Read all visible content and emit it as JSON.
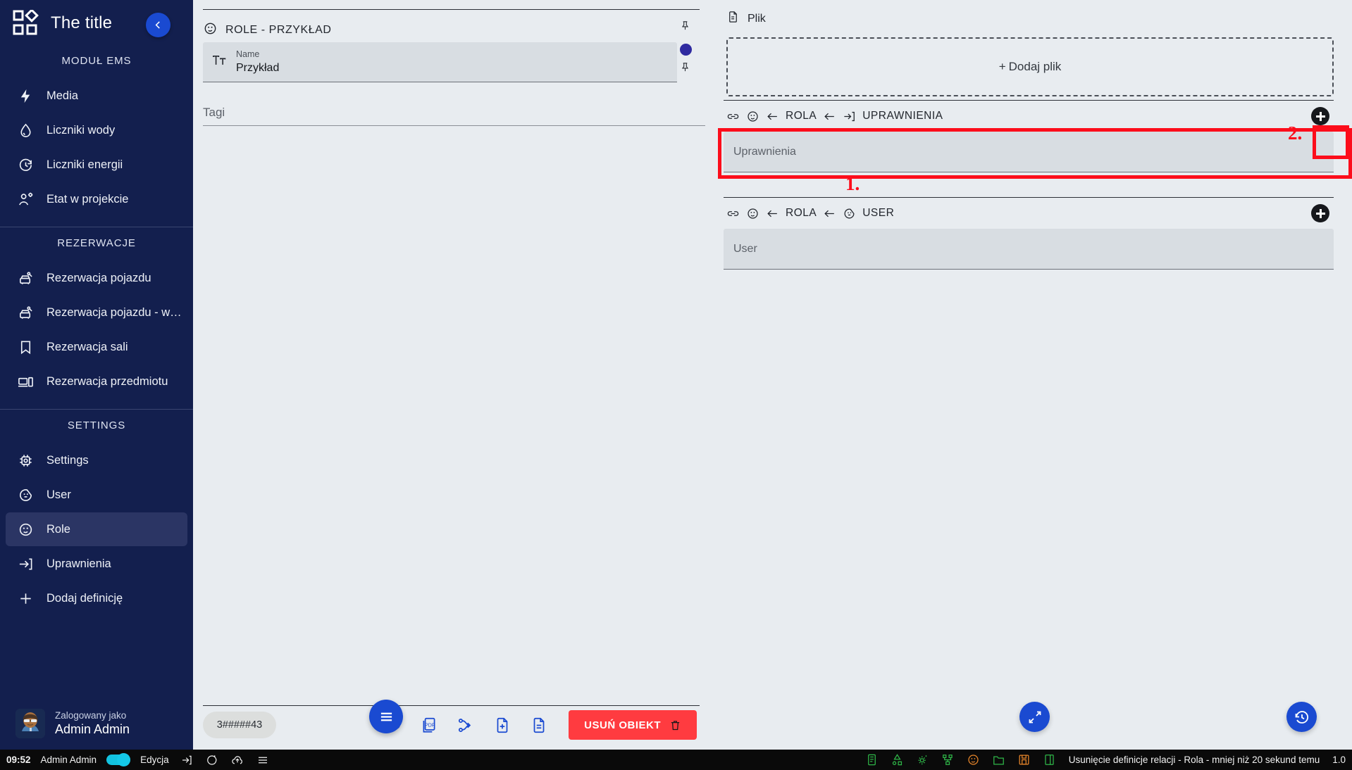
{
  "sidebar": {
    "brand_title": "The title",
    "sections": [
      {
        "title": "MODUŁ EMS",
        "items": [
          {
            "label": "Media",
            "icon": "bolt-icon"
          },
          {
            "label": "Liczniki wody",
            "icon": "water-drop-icon"
          },
          {
            "label": "Liczniki energii",
            "icon": "energy-meter-icon"
          },
          {
            "label": "Etat w projekcie",
            "icon": "user-settings-icon"
          }
        ]
      },
      {
        "title": "REZERWACJE",
        "items": [
          {
            "label": "Rezerwacja pojazdu",
            "icon": "car-key-icon"
          },
          {
            "label": "Rezerwacja pojazdu - wni…",
            "icon": "car-key-icon"
          },
          {
            "label": "Rezerwacja sali",
            "icon": "bookmark-icon"
          },
          {
            "label": "Rezerwacja przedmiotu",
            "icon": "devices-icon"
          }
        ]
      },
      {
        "title": "SETTINGS",
        "items": [
          {
            "label": "Settings",
            "icon": "chip-gear-icon"
          },
          {
            "label": "User",
            "icon": "user-face-icon"
          },
          {
            "label": "Role",
            "icon": "role-face-icon",
            "active": true
          },
          {
            "label": "Uprawnienia",
            "icon": "arrow-into-bracket-icon"
          },
          {
            "label": "Dodaj definicję",
            "icon": "plus-icon"
          }
        ]
      }
    ],
    "user": {
      "caption": "Zalogowany jako",
      "name": "Admin Admin"
    },
    "collapse_label": "‹"
  },
  "center": {
    "object_title": "ROLE - PRZYKŁAD",
    "name_field": {
      "label": "Name",
      "value": "Przykład",
      "icon": "text-format-icon"
    },
    "tags_placeholder": "Tagi",
    "id_chip": "3#####43",
    "toolbar": {
      "buttons": [
        {
          "name": "cloud-download-icon"
        },
        {
          "name": "pdf-copy-icon"
        },
        {
          "name": "merge-branch-icon"
        },
        {
          "name": "file-add-icon"
        },
        {
          "name": "file-icon"
        }
      ],
      "delete_label": "USUŃ OBIEKT"
    },
    "menu_fab": "hamburger-icon"
  },
  "right": {
    "file_section": {
      "title": "Plik",
      "dropzone_label": "Dodaj plik",
      "dropzone_plus": "+"
    },
    "relations": [
      {
        "crumb": [
          "ROLA",
          "UPRAWNIENIA"
        ],
        "icons": [
          "link-icon",
          "role-face-icon",
          "arrow-left-icon",
          "arrow-left-icon",
          "arrow-into-bracket-icon"
        ],
        "field_label": "Uprawnienia",
        "highlighted": true
      },
      {
        "crumb": [
          "ROLA",
          "USER"
        ],
        "icons": [
          "link-icon",
          "role-face-icon",
          "arrow-left-icon",
          "arrow-left-icon",
          "user-face-icon"
        ],
        "field_label": "User",
        "highlighted": false
      }
    ],
    "annotations": [
      {
        "number": "1."
      },
      {
        "number": "2."
      }
    ],
    "fabs": [
      {
        "name": "expand-icon"
      },
      {
        "name": "history-icon"
      }
    ]
  },
  "statusbar": {
    "time": "09:52",
    "user": "Admin Admin",
    "mode": "Edycja",
    "left_icons": [
      "logout-icon",
      "refresh-icon",
      "cloud-upload-icon",
      "menu-icon"
    ],
    "tray_icons": [
      "document-green-icon",
      "diagram-green-icon",
      "gear-green-icon",
      "hierarchy-green-icon",
      "role-orange-icon",
      "folder-green-icon",
      "save-orange-icon",
      "panel-green-icon"
    ],
    "message": "Usunięcie definicje relacji - Rola - mniej niż 20 sekund temu",
    "version": "1.0"
  },
  "colors": {
    "sidebar_bg": "#131f4e",
    "sidebar_active": "#2b3564",
    "accent_blue": "#1a4ad1",
    "page_bg": "#e8ecf0",
    "field_bg": "#d8dde2",
    "danger": "#ff3b40",
    "annotation_red": "#fc0d1b",
    "indicator_purple": "#2f2aa0"
  }
}
